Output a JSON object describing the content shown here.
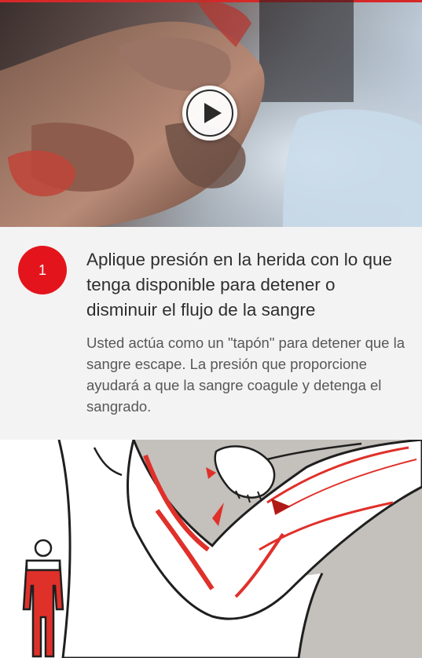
{
  "video": {
    "play_icon": "play-icon",
    "accent_color": "#d62828"
  },
  "step": {
    "number": "1",
    "title": "Aplique presión en la herida con lo que tenga disponible para detener o disminuir el flujo de la sangre",
    "description": "Usted actúa como un \"tapón\" para detener que la sangre escape. La presión que proporcione ayudará a que la sangre coagule y detenga el sangrado.",
    "badge_color": "#e4141c"
  },
  "illustration": {
    "figure_icon": "human-figure-icon",
    "blood_color": "#e0302a"
  }
}
